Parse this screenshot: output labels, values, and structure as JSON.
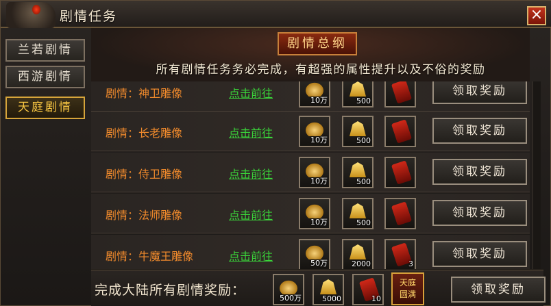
{
  "window": {
    "title": "剧情任务"
  },
  "tabs": [
    {
      "label": "兰若剧情",
      "active": false
    },
    {
      "label": "西游剧情",
      "active": false
    },
    {
      "label": "天庭剧情",
      "active": true
    }
  ],
  "banner": {
    "title": "剧情总纲",
    "description": "所有剧情任务务必完成，有超强的属性提升以及不俗的奖励"
  },
  "quests": [
    {
      "name": "剧情：神卫雕像",
      "link": "点击前往",
      "rewards": [
        {
          "icon": "ingot-icon",
          "qty": "10万"
        },
        {
          "icon": "gold-bars-icon",
          "qty": "500"
        },
        {
          "icon": "red-envelope-icon",
          "qty": ""
        }
      ],
      "button": "领取奖励"
    },
    {
      "name": "剧情：长老雕像",
      "link": "点击前往",
      "rewards": [
        {
          "icon": "ingot-icon",
          "qty": "10万"
        },
        {
          "icon": "gold-bars-icon",
          "qty": "500"
        },
        {
          "icon": "red-envelope-icon",
          "qty": ""
        }
      ],
      "button": "领取奖励"
    },
    {
      "name": "剧情：侍卫雕像",
      "link": "点击前往",
      "rewards": [
        {
          "icon": "ingot-icon",
          "qty": "10万"
        },
        {
          "icon": "gold-bars-icon",
          "qty": "500"
        },
        {
          "icon": "red-envelope-icon",
          "qty": ""
        }
      ],
      "button": "领取奖励"
    },
    {
      "name": "剧情：法师雕像",
      "link": "点击前往",
      "rewards": [
        {
          "icon": "ingot-icon",
          "qty": "10万"
        },
        {
          "icon": "gold-bars-icon",
          "qty": "500"
        },
        {
          "icon": "red-envelope-icon",
          "qty": ""
        }
      ],
      "button": "领取奖励"
    },
    {
      "name": "剧情：牛魔王雕像",
      "link": "点击前往",
      "rewards": [
        {
          "icon": "ingot-icon",
          "qty": "50万"
        },
        {
          "icon": "gold-bars-icon",
          "qty": "2000"
        },
        {
          "icon": "red-envelope-icon",
          "qty": "3"
        }
      ],
      "button": "领取奖励"
    }
  ],
  "bottom": {
    "label": "完成大陆所有剧情奖励：",
    "rewards": [
      {
        "icon": "ingot-icon",
        "qty": "500万"
      },
      {
        "icon": "gold-bars-icon",
        "qty": "5000"
      },
      {
        "icon": "red-envelope-icon",
        "qty": "10"
      }
    ],
    "badge": {
      "line1": "天庭",
      "line2": "圆满"
    },
    "button": "领取奖励"
  },
  "colors": {
    "accent_gold": "#d6a43a",
    "link_green": "#3ad43a",
    "quest_orange": "#f08a2c",
    "close_red": "#c2341c"
  }
}
